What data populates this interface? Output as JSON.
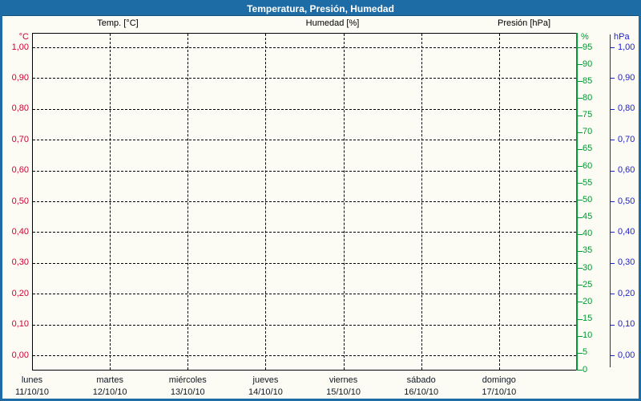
{
  "window_title": "Temperatura, Presión, Humedad",
  "colors": {
    "titlebar": "#1d6ca6",
    "background": "#fcfcf4",
    "grid": "#000000",
    "temp": "#cc0033",
    "humidity": "#009933",
    "pressure": "#2020cc",
    "daytext": "#101820"
  },
  "legend": [
    {
      "label": "Temp. [°C]",
      "series": "temp"
    },
    {
      "label": "Humedad [%]",
      "series": "humidity"
    },
    {
      "label": "Presión [hPa]",
      "series": "pressure"
    }
  ],
  "chart_data": {
    "type": "line",
    "title": "Temperatura, Presión, Humedad",
    "empty": true,
    "grid": true,
    "legend_position": "top",
    "series": [
      {
        "name": "Temp. [°C]",
        "color": "#cc0033",
        "axis": "temperature",
        "values": []
      },
      {
        "name": "Humedad [%]",
        "color": "#009933",
        "axis": "humidity",
        "values": []
      },
      {
        "name": "Presión [hPa]",
        "color": "#2020cc",
        "axis": "pressure",
        "values": []
      }
    ],
    "x_axis": {
      "days": [
        {
          "name": "lunes",
          "date": "11/10/10"
        },
        {
          "name": "martes",
          "date": "12/10/10"
        },
        {
          "name": "miércoles",
          "date": "13/10/10"
        },
        {
          "name": "jueves",
          "date": "14/10/10"
        },
        {
          "name": "viernes",
          "date": "15/10/10"
        },
        {
          "name": "sábado",
          "date": "16/10/10"
        },
        {
          "name": "domingo",
          "date": "17/10/10"
        }
      ]
    },
    "temperature_axis": {
      "unit": "°C",
      "tick_labels": [
        "1,00",
        "0,90",
        "0,80",
        "0,70",
        "0,60",
        "0,50",
        "0,40",
        "0,30",
        "0,20",
        "0,10",
        "0,00"
      ],
      "range": [
        0.0,
        1.0
      ]
    },
    "humidity_axis": {
      "unit": "%",
      "tick_labels": [
        "95",
        "90",
        "85",
        "80",
        "75",
        "70",
        "65",
        "60",
        "55",
        "50",
        "45",
        "40",
        "35",
        "30",
        "25",
        "20",
        "15",
        "10",
        "5",
        "0"
      ],
      "range": [
        0,
        100
      ]
    },
    "pressure_axis": {
      "unit": "hPa",
      "tick_labels": [
        "1,00",
        "0,90",
        "0,80",
        "0,70",
        "0,60",
        "0,50",
        "0,40",
        "0,30",
        "0,20",
        "0,10",
        "0,00"
      ],
      "range": [
        0.0,
        1.0
      ]
    }
  }
}
